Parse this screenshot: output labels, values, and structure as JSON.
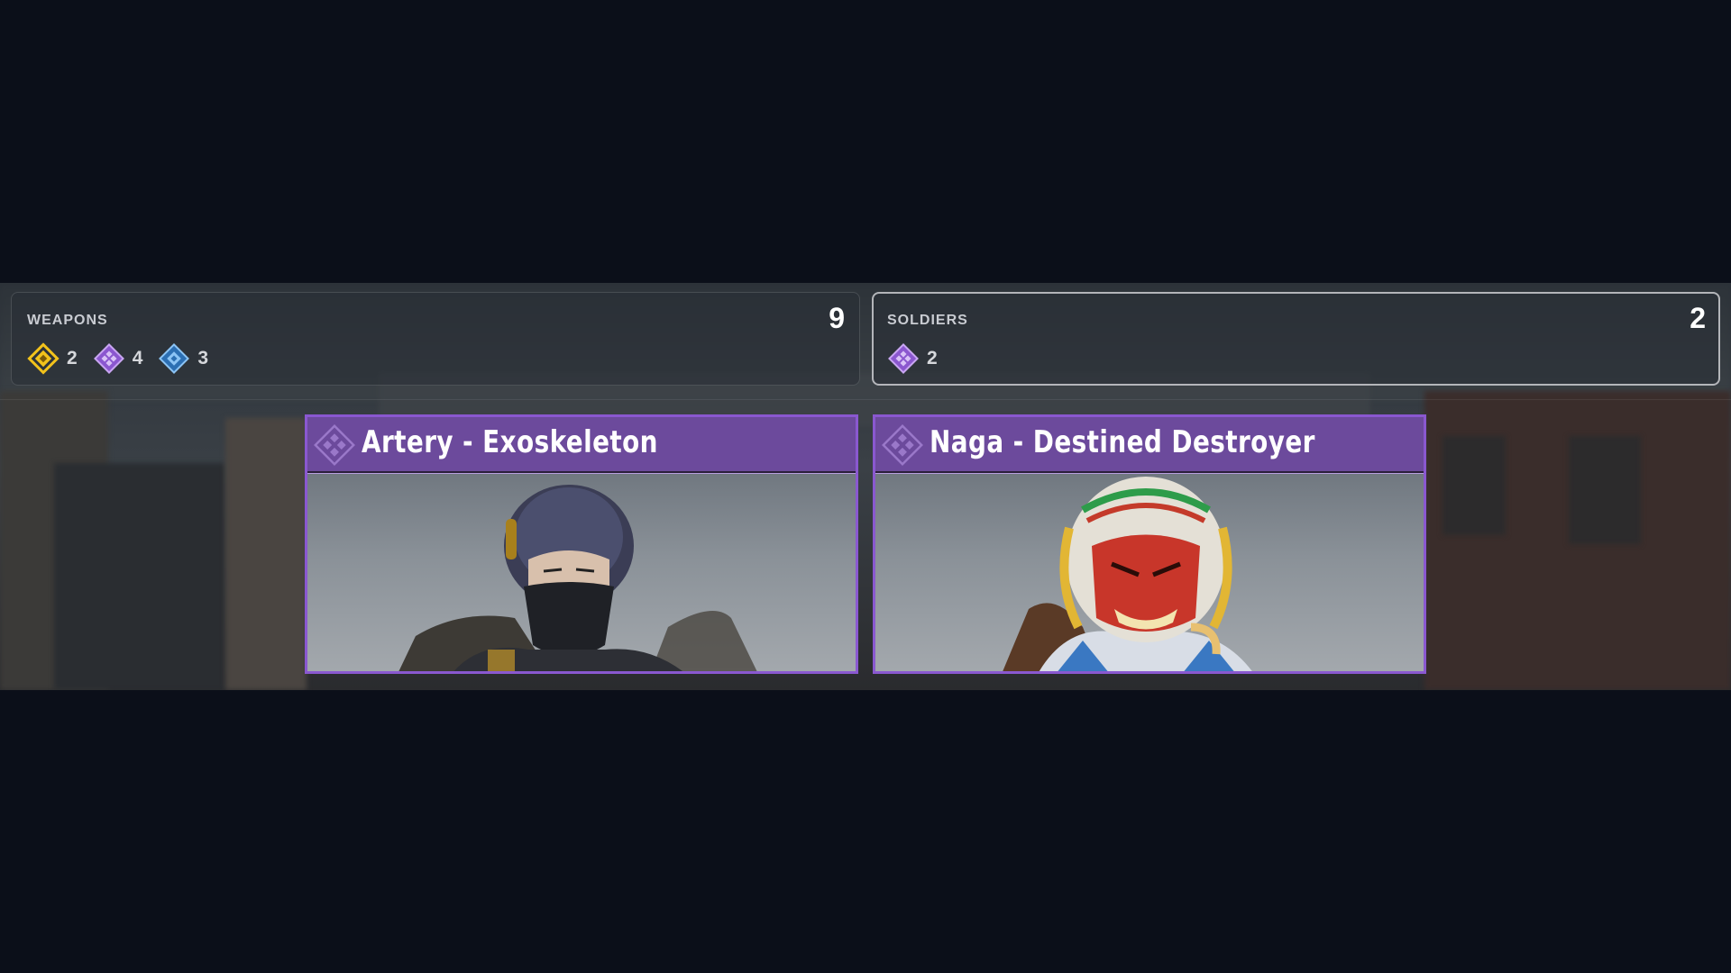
{
  "weapons": {
    "title": "WEAPONS",
    "total": "9",
    "rarities": [
      {
        "icon": "legendary-diamond-icon",
        "color": "#f2c21b",
        "count": "2"
      },
      {
        "icon": "epic-diamond-icon",
        "color": "#a66fe0",
        "count": "4"
      },
      {
        "icon": "rare-diamond-icon",
        "color": "#4f9de6",
        "count": "3"
      }
    ]
  },
  "soldiers": {
    "title": "SOLDIERS",
    "total": "2",
    "rarities": [
      {
        "icon": "epic-diamond-icon",
        "color": "#a66fe0",
        "count": "2"
      }
    ]
  },
  "cards": [
    {
      "title": "Artery - Exoskeleton",
      "rarity_icon": "epic-diamond-icon",
      "accent": "#8a58d0"
    },
    {
      "title": "Naga - Destined Destroyer",
      "rarity_icon": "epic-diamond-icon",
      "accent": "#8a58d0"
    }
  ]
}
